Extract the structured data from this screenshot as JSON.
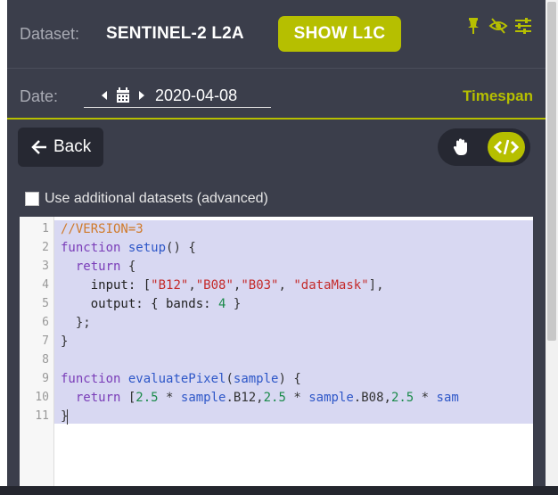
{
  "header": {
    "dataset_label": "Dataset:",
    "dataset_value": "SENTINEL-2 L2A",
    "show_l1c_label": "SHOW L1C",
    "icons": [
      "pin-icon",
      "eye-slash-icon",
      "sliders-icon"
    ]
  },
  "date_row": {
    "date_label": "Date:",
    "date_value": "2020-04-08",
    "timespan_label": "Timespan"
  },
  "toolbar": {
    "back_arrow": "🡐",
    "back_label": "Back",
    "mode_icons": [
      "hand-icon",
      "code-icon"
    ],
    "active_mode": "code"
  },
  "options": {
    "use_additional_label": "Use additional datasets (advanced)",
    "use_additional_checked": false
  },
  "editor": {
    "line_numbers": [
      "1",
      "2",
      "3",
      "4",
      "5",
      "6",
      "7",
      "8",
      "9",
      "10",
      "11"
    ],
    "lines": {
      "l1_comment": "//VERSION=3",
      "l2_kw": "function",
      "l2_fn": "setup",
      "l2_rest": "() {",
      "l3_kw": "return",
      "l3_rest": " {",
      "l4_prop": "input: [",
      "l4_s1": "\"B12\"",
      "l4_c1": ",",
      "l4_s2": "\"B08\"",
      "l4_c2": ",",
      "l4_s3": "\"B03\"",
      "l4_c3": ", ",
      "l4_s4": "\"dataMask\"",
      "l4_end": "],",
      "l5_prop": "output: { bands: ",
      "l5_num": "4",
      "l5_end": " }",
      "l6": "};",
      "l7": "}",
      "l9_kw": "function",
      "l9_fn": "evaluatePixel",
      "l9_open": "(",
      "l9_arg": "sample",
      "l9_end": ") {",
      "l10_kw": "return",
      "l10_open": " [",
      "l10_n1": "2.5",
      "l10_t1": " * ",
      "l10_v1": "sample",
      "l10_p1": ".B12,",
      "l10_n2": "2.5",
      "l10_t2": " * ",
      "l10_v2": "sample",
      "l10_p2": ".B08,",
      "l10_n3": "2.5",
      "l10_t3": " * ",
      "l10_v3": "sam",
      "l11": "}"
    }
  },
  "colors": {
    "panel_bg": "#3b3e4b",
    "accent": "#b6bf00",
    "selection": "#d8d8f2"
  }
}
